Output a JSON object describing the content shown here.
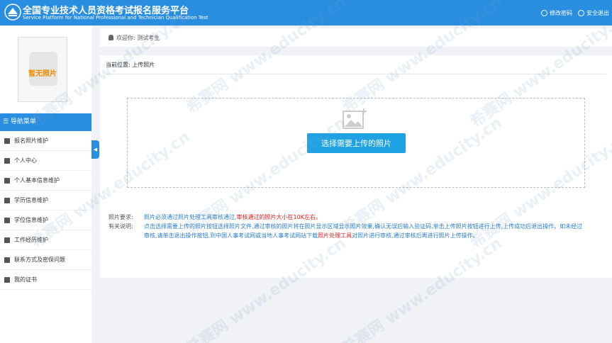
{
  "header": {
    "title_cn": "全国专业技术人员资格考试报名服务平台",
    "title_en": "Service Platform for National Professional and Technician Qualification Test",
    "actions": [
      {
        "label": "修改密码",
        "icon": "settings-icon"
      },
      {
        "label": "安全退出",
        "icon": "power-icon"
      }
    ]
  },
  "sidebar": {
    "photo_text": "暂无照片",
    "nav_title": "☰ 导航菜单",
    "items": [
      {
        "label": "报名照片维护",
        "icon": "photo-icon"
      },
      {
        "label": "个人中心",
        "icon": "home-icon"
      },
      {
        "label": "个人基本信息维护",
        "icon": "user-icon"
      },
      {
        "label": "学历信息维护",
        "icon": "graduation-icon"
      },
      {
        "label": "学位信息维护",
        "icon": "medal-icon"
      },
      {
        "label": "工作经历维护",
        "icon": "briefcase-icon"
      },
      {
        "label": "联系方式及密保问题",
        "icon": "phone-icon"
      },
      {
        "label": "我的证书",
        "icon": "book-icon"
      }
    ],
    "collapse_glyph": "◀"
  },
  "welcome": {
    "icon": "user-icon",
    "text": "欢迎你:  测试考生"
  },
  "breadcrumb": "当前位置:  上传照片",
  "upload": {
    "button_label": "选择需要上传的照片",
    "icon": "image-add-icon"
  },
  "notes": {
    "req_label": "照片要求:",
    "req_text": "照片必须通过照片处理工具审核通过,",
    "req_red": "审核通过的照片大小在10K左右。",
    "instr_label": "有关说明:",
    "instr_text1": "点击选择需要上传的照片按钮选择照片文件,通过审核的照片将在照片显示区域显示照片效果,确认无误后输入验证码,单击上传照片按钮进行上传,上传成功后退出操作。如未经过审核,请单击退出操作按钮,到中国人事考试网或当地人事考试网站下载",
    "instr_red": "照片处理工具",
    "instr_text2": "对照片进行审核,通过审核后再进行照片上传操作。"
  },
  "watermark": "希赛网 www.educity.cn"
}
